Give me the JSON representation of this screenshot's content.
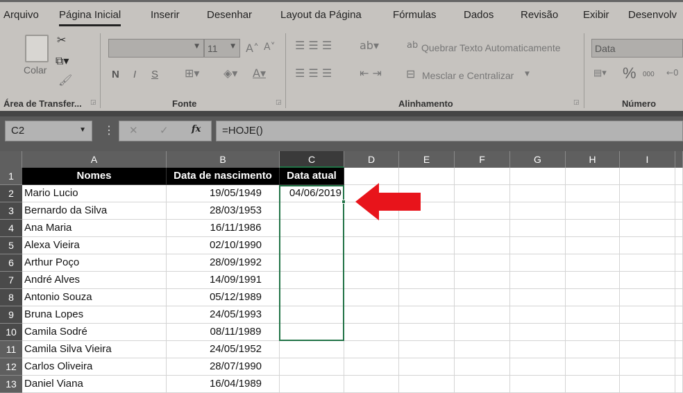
{
  "tabs": [
    "Arquivo",
    "Página Inicial",
    "Inserir",
    "Desenhar",
    "Layout da Página",
    "Fórmulas",
    "Dados",
    "Revisão",
    "Exibir",
    "Desenvolv"
  ],
  "ribbon": {
    "paste_label": "Colar",
    "font_size": "11",
    "wrap_text": "Quebrar Texto Automaticamente",
    "merge_center": "Mesclar e Centralizar",
    "number_format": "Data",
    "bold": "N",
    "italic": "I",
    "underline": "S",
    "percent": "%",
    "thousands": "000",
    "groups": [
      "Área de Transfer...",
      "Fonte",
      "Alinhamento",
      "Número"
    ]
  },
  "formula_bar": {
    "name_box": "C2",
    "formula": "=HOJE()",
    "fx": "fx"
  },
  "columns": [
    "A",
    "B",
    "C",
    "D",
    "E",
    "F",
    "G",
    "H",
    "I"
  ],
  "rows": [
    {
      "n": "1",
      "a": "Nomes",
      "b": "Data de nascimento",
      "c": "Data atual"
    },
    {
      "n": "2",
      "a": "Mario Lucio",
      "b": "19/05/1949",
      "c": "04/06/2019"
    },
    {
      "n": "3",
      "a": "Bernardo da Silva",
      "b": "28/03/1953",
      "c": ""
    },
    {
      "n": "4",
      "a": "Ana Maria",
      "b": "16/11/1986",
      "c": ""
    },
    {
      "n": "5",
      "a": "Alexa Vieira",
      "b": "02/10/1990",
      "c": ""
    },
    {
      "n": "6",
      "a": "Arthur Poço",
      "b": "28/09/1992",
      "c": ""
    },
    {
      "n": "7",
      "a": "André Alves",
      "b": "14/09/1991",
      "c": ""
    },
    {
      "n": "8",
      "a": "Antonio Souza",
      "b": "05/12/1989",
      "c": ""
    },
    {
      "n": "9",
      "a": "Bruna  Lopes",
      "b": "24/05/1993",
      "c": ""
    },
    {
      "n": "10",
      "a": "Camila Sodré",
      "b": "08/11/1989",
      "c": ""
    },
    {
      "n": "11",
      "a": "Camila   Silva Vieira",
      "b": "24/05/1952",
      "c": ""
    },
    {
      "n": "12",
      "a": "Carlos Oliveira",
      "b": "28/07/1990",
      "c": ""
    },
    {
      "n": "13",
      "a": "Daniel Viana",
      "b": "16/04/1989",
      "c": ""
    }
  ],
  "colors": {
    "selection": "#217346",
    "arrow": "#e8141b"
  }
}
